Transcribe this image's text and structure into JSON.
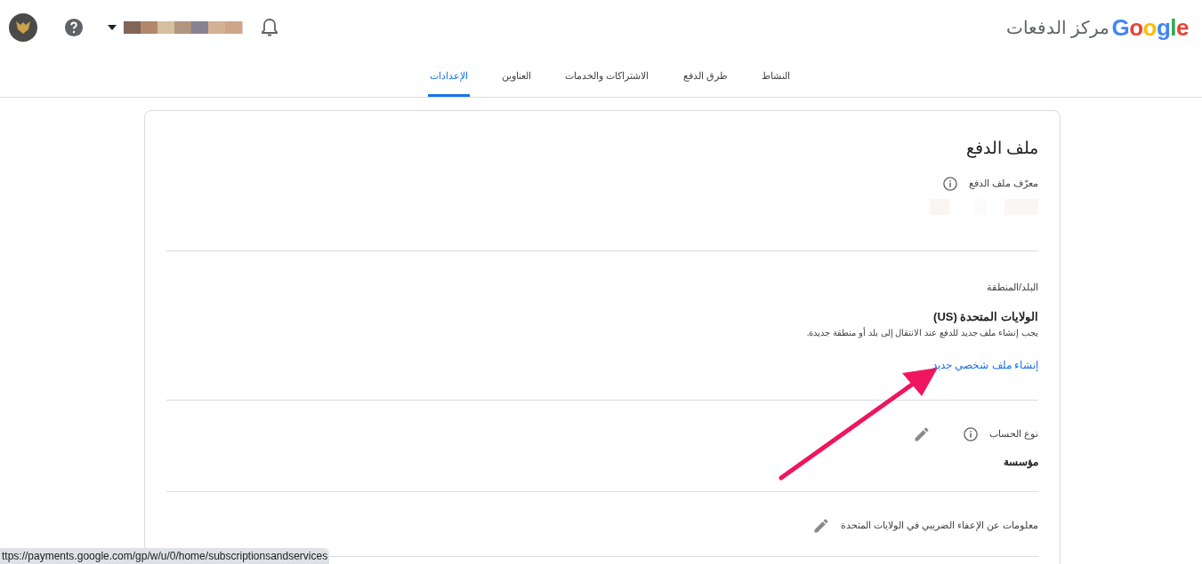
{
  "header": {
    "logo": "Google",
    "product": "مركز الدفعات"
  },
  "tabs": [
    {
      "label": "النشاط",
      "selected": false
    },
    {
      "label": "طرق الدفع",
      "selected": false
    },
    {
      "label": "الاشتراكات والخدمات",
      "selected": false
    },
    {
      "label": "العناوين",
      "selected": false
    },
    {
      "label": "الإعدادات",
      "selected": true
    }
  ],
  "card": {
    "title": "ملف الدفع",
    "sections": [
      {
        "kind": "id",
        "label": "معرّف ملف الدفع",
        "info": true,
        "editable": false
      },
      {
        "kind": "region",
        "label": "البلد/المنطقة",
        "value": "الولايات المتحدة (US)",
        "note": "يجب إنشاء ملف جديد للدفع عند الانتقال إلى بلد أو منطقة جديدة.",
        "link": "إنشاء ملف شخصي جديد"
      },
      {
        "kind": "field",
        "label": "نوع الحساب",
        "info": true,
        "editable": true,
        "value": "مؤسسة"
      },
      {
        "kind": "field",
        "label": "معلومات عن الإعفاء الضريبي في الولايات المتحدة",
        "info": false,
        "editable": true
      }
    ]
  },
  "status_bar": {
    "url": "ttps://payments.google.com/gp/w/u/0/home/subscriptionsandservices"
  }
}
